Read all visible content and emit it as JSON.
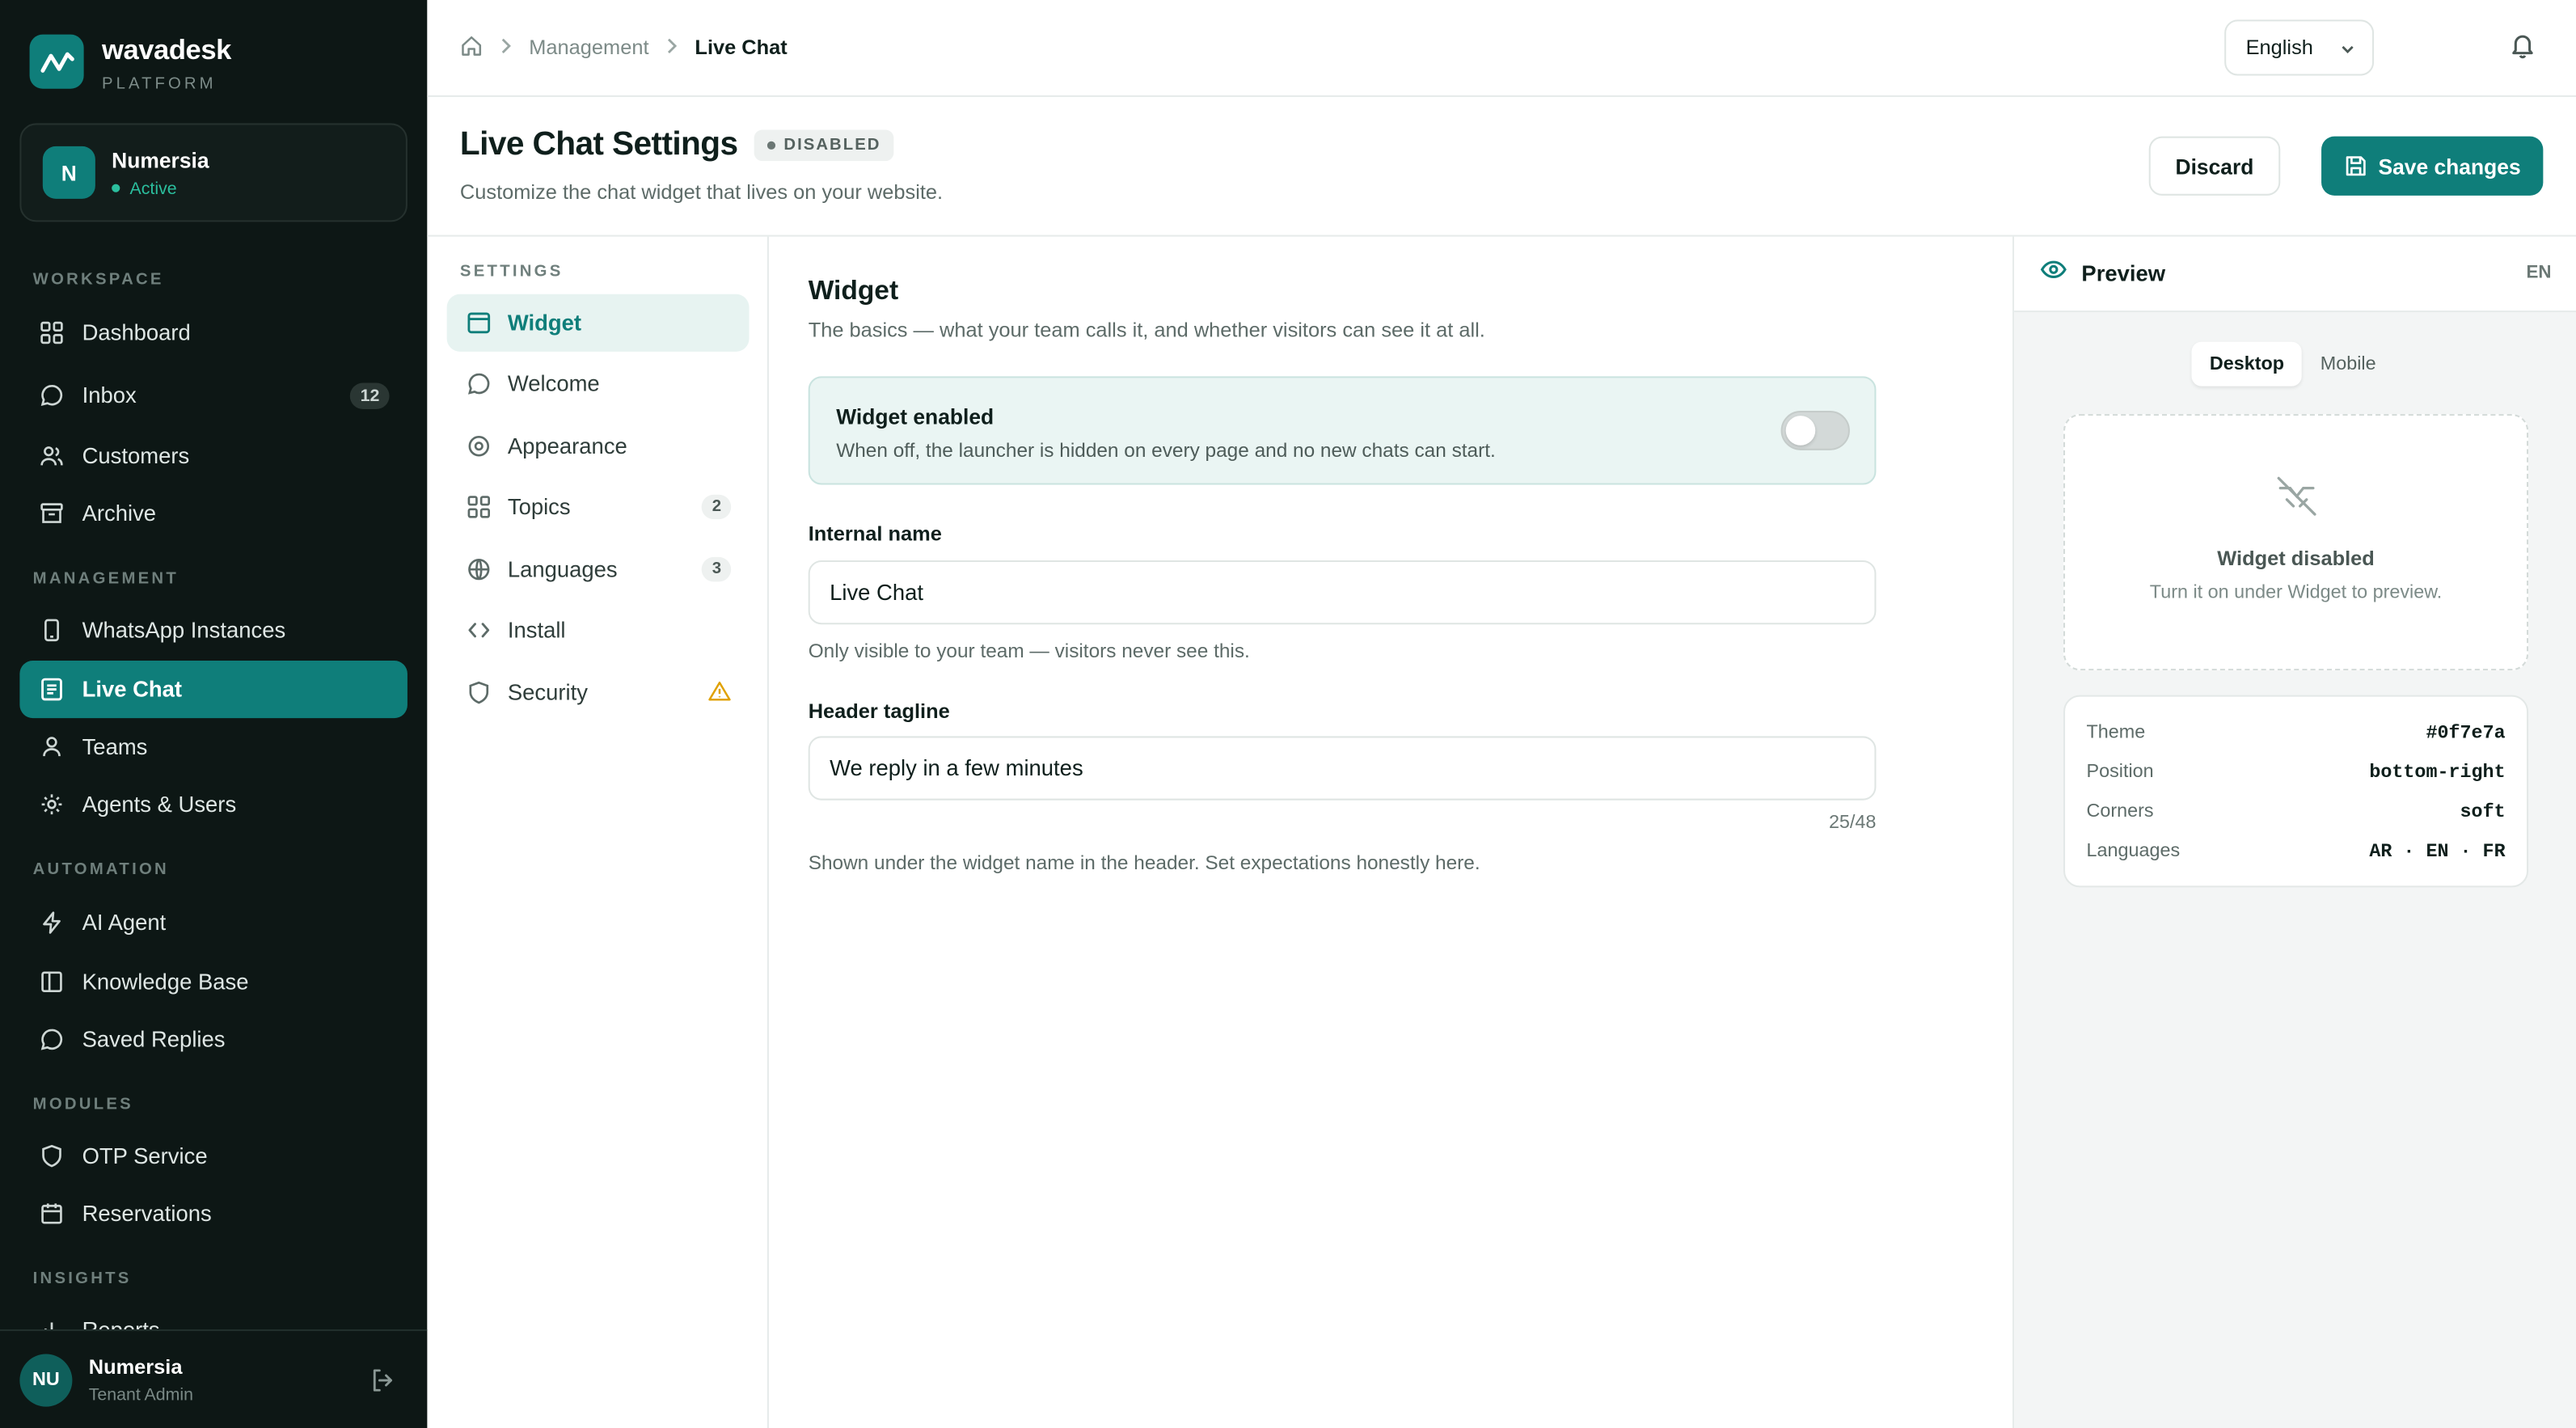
{
  "brand": {
    "name": "wavadesk",
    "sub": "PLATFORM",
    "accent": "#0f7e7a"
  },
  "tenant": {
    "initial": "N",
    "name": "Numersia",
    "status": "Active"
  },
  "nav": {
    "sections": [
      "WORKSPACE",
      "MANAGEMENT",
      "AUTOMATION",
      "MODULES",
      "INSIGHTS"
    ],
    "items": [
      {
        "label": "Dashboard",
        "icon": "grid-icon"
      },
      {
        "label": "Inbox",
        "icon": "chat-icon",
        "count": "12"
      },
      {
        "label": "Customers",
        "icon": "users-icon"
      },
      {
        "label": "Archive",
        "icon": "archive-icon"
      },
      {
        "label": "WhatsApp Instances",
        "icon": "phone-icon"
      },
      {
        "label": "Live Chat",
        "icon": "document-icon",
        "active": true
      },
      {
        "label": "Teams",
        "icon": "user-icon"
      },
      {
        "label": "Agents & Users",
        "icon": "gear-icon"
      },
      {
        "label": "AI Agent",
        "icon": "bolt-icon"
      },
      {
        "label": "Knowledge Base",
        "icon": "book-icon"
      },
      {
        "label": "Saved Replies",
        "icon": "chat-icon"
      },
      {
        "label": "OTP Service",
        "icon": "shield-icon"
      },
      {
        "label": "Reservations",
        "icon": "calendar-icon"
      },
      {
        "label": "Reports",
        "icon": "chart-icon"
      }
    ]
  },
  "user": {
    "initials": "NU",
    "name": "Numersia",
    "role": "Tenant Admin"
  },
  "breadcrumb": {
    "parent": "Management",
    "current": "Live Chat"
  },
  "language_select": {
    "value": "English"
  },
  "page": {
    "title": "Live Chat Settings",
    "badge": "DISABLED",
    "subtitle": "Customize the chat widget that lives on your website.",
    "discard_label": "Discard",
    "save_label": "Save changes"
  },
  "settings_nav": {
    "label": "SETTINGS",
    "items": [
      {
        "label": "Widget",
        "icon": "window-icon",
        "active": true
      },
      {
        "label": "Welcome",
        "icon": "chat-icon"
      },
      {
        "label": "Appearance",
        "icon": "palette-icon"
      },
      {
        "label": "Topics",
        "icon": "grid-icon",
        "count": "2"
      },
      {
        "label": "Languages",
        "icon": "globe-icon",
        "count": "3"
      },
      {
        "label": "Install",
        "icon": "code-icon"
      },
      {
        "label": "Security",
        "icon": "shield-icon",
        "warning": true
      }
    ]
  },
  "widget_form": {
    "title": "Widget",
    "subtitle": "The basics — what your team calls it, and whether visitors can see it at all.",
    "toggle": {
      "title": "Widget enabled",
      "description": "When off, the launcher is hidden on every page and no new chats can start.",
      "on": false
    },
    "internal_name": {
      "label": "Internal name",
      "value": "Live Chat",
      "help": "Only visible to your team — visitors never see this."
    },
    "tagline": {
      "label": "Header tagline",
      "value": "We reply in a few minutes",
      "counter": "25/48",
      "help": "Shown under the widget name in the header. Set expectations honestly here."
    }
  },
  "preview": {
    "title": "Preview",
    "lang": "EN",
    "tabs": [
      "Desktop",
      "Mobile"
    ],
    "disabled_title": "Widget disabled",
    "disabled_sub": "Turn it on under Widget to preview.",
    "info": [
      {
        "key": "Theme",
        "value": "#0f7e7a"
      },
      {
        "key": "Position",
        "value": "bottom-right"
      },
      {
        "key": "Corners",
        "value": "soft"
      },
      {
        "key": "Languages",
        "value": "AR · EN · FR"
      }
    ]
  }
}
